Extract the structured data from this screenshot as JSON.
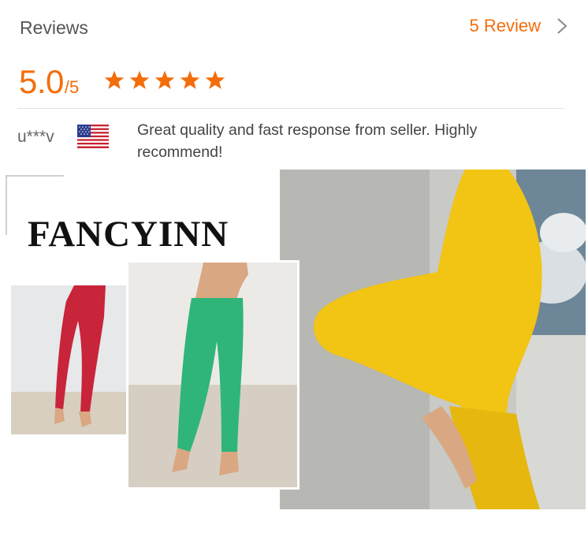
{
  "header": {
    "title": "Reviews",
    "review_count_label": "5 Review"
  },
  "rating": {
    "score": "5.0",
    "denominator": "/5",
    "stars": 5
  },
  "review": {
    "username": "u***v",
    "country_flag": "us-flag-icon",
    "comment": "Great quality and fast response from seller. Highly recommend!"
  },
  "gallery": {
    "brand": "FANCYINN"
  },
  "colors": {
    "accent": "#f36d0b",
    "text_muted": "#555555"
  }
}
